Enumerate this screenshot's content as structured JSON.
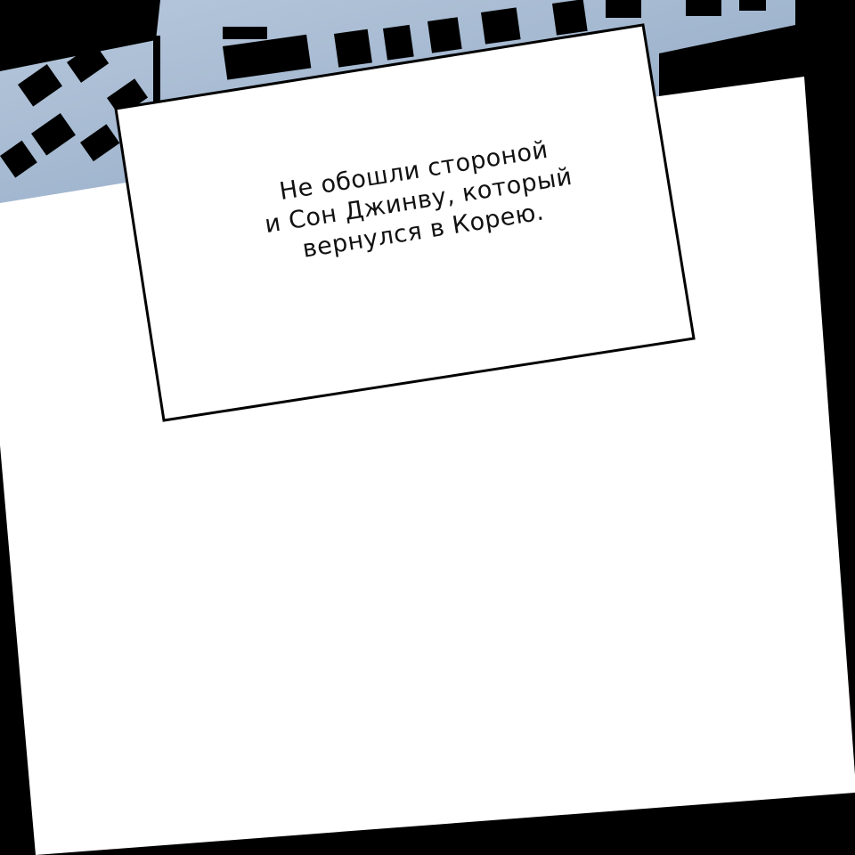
{
  "caption": {
    "lines": [
      "Не обошли стороной",
      "и Сон Джинву, который",
      "вернулся в Корею."
    ]
  },
  "colors": {
    "sky_building": "#9fb5cf",
    "panel": "#ffffff",
    "border": "#000000"
  }
}
